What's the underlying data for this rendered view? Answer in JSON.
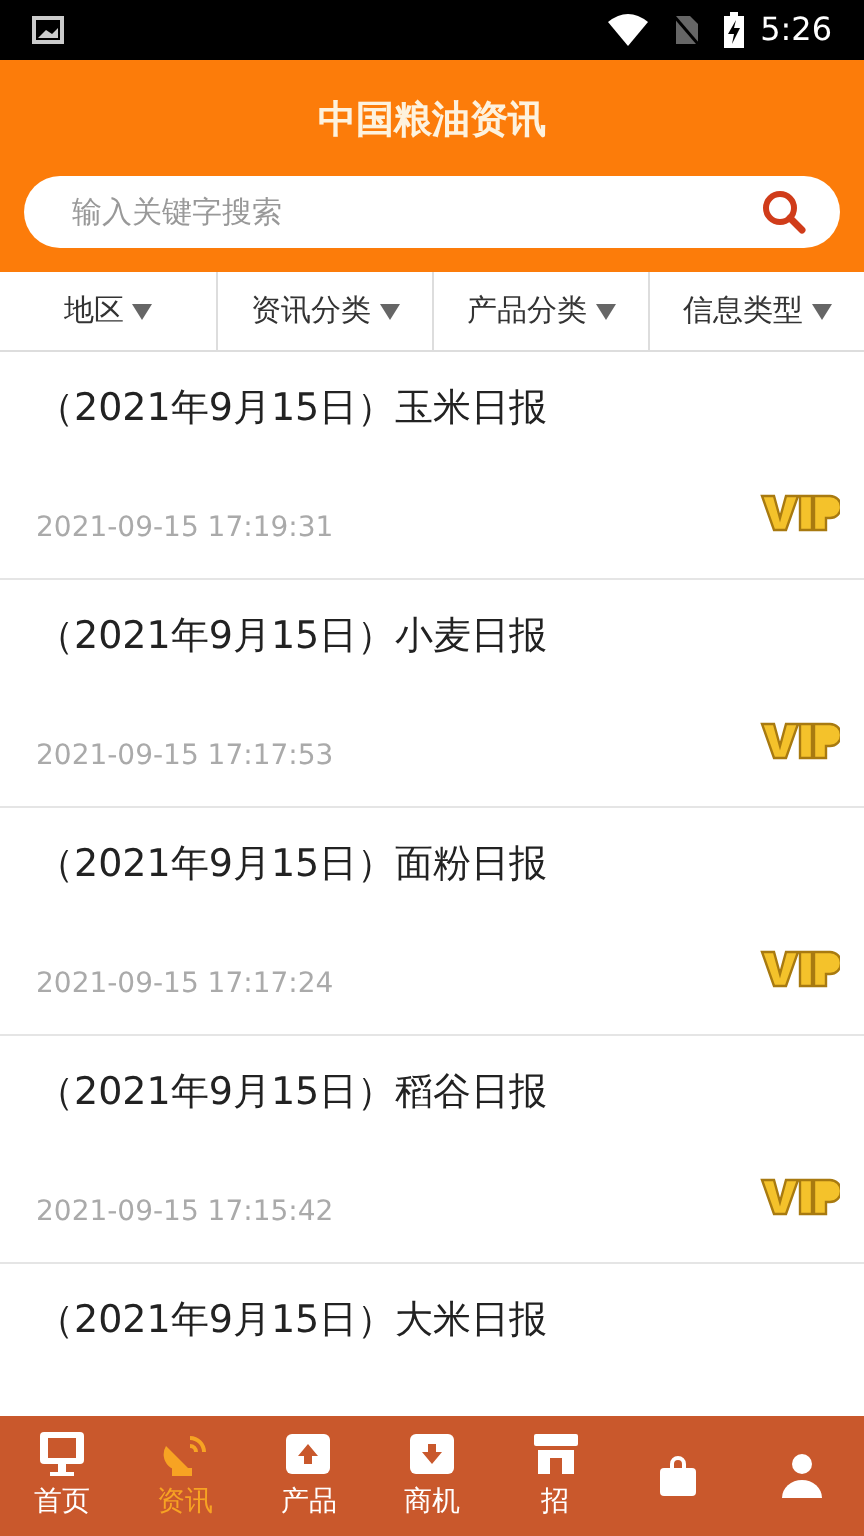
{
  "status_bar": {
    "time": "5:26"
  },
  "header": {
    "title": "中国粮油资讯"
  },
  "search": {
    "placeholder": "输入关键字搜索"
  },
  "filters": [
    "地区",
    "资讯分类",
    "产品分类",
    "信息类型"
  ],
  "articles": [
    {
      "title": "（2021年9月15日）玉米日报",
      "time": "2021-09-15 17:19:31",
      "vip": true
    },
    {
      "title": "（2021年9月15日）小麦日报",
      "time": "2021-09-15 17:17:53",
      "vip": true
    },
    {
      "title": "（2021年9月15日）面粉日报",
      "time": "2021-09-15 17:17:24",
      "vip": true
    },
    {
      "title": "（2021年9月15日）稻谷日报",
      "time": "2021-09-15 17:15:42",
      "vip": true
    },
    {
      "title": "（2021年9月15日）大米日报",
      "vip": false
    }
  ],
  "nav": [
    {
      "kind": "home",
      "label": "首页",
      "selected": false
    },
    {
      "kind": "news",
      "label": "资讯",
      "selected": true
    },
    {
      "kind": "upload",
      "label": "产品",
      "selected": false
    },
    {
      "kind": "download",
      "label": "商机",
      "selected": false
    },
    {
      "kind": "shop",
      "label": "招",
      "selected": false
    },
    {
      "kind": "bag",
      "selected": false
    },
    {
      "kind": "user",
      "selected": false
    }
  ]
}
